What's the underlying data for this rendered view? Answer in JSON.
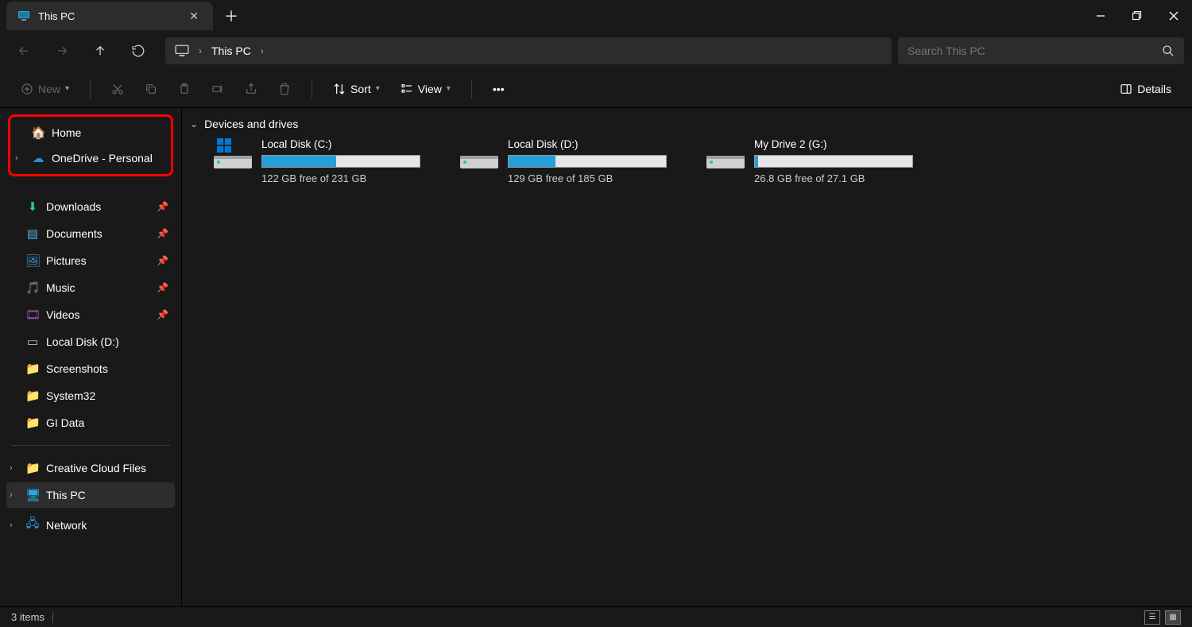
{
  "window": {
    "tab_title": "This PC",
    "search_placeholder": "Search This PC"
  },
  "address": {
    "segment": "This PC"
  },
  "toolbar": {
    "new": "New",
    "sort": "Sort",
    "view": "View",
    "details": "Details"
  },
  "sidebar": {
    "home": "Home",
    "onedrive": "OneDrive - Personal",
    "downloads": "Downloads",
    "documents": "Documents",
    "pictures": "Pictures",
    "music": "Music",
    "videos": "Videos",
    "local_disk_d": "Local Disk (D:)",
    "screenshots": "Screenshots",
    "system32": "System32",
    "gi_data": "GI Data",
    "creative_cloud": "Creative Cloud Files",
    "this_pc": "This PC",
    "network": "Network"
  },
  "main": {
    "section": "Devices and drives",
    "drives": [
      {
        "name": "Local Disk (C:)",
        "free": "122 GB free of 231 GB",
        "fill_pct": 47
      },
      {
        "name": "Local Disk (D:)",
        "free": "129 GB free of 185 GB",
        "fill_pct": 30
      },
      {
        "name": "My Drive 2 (G:)",
        "free": "26.8 GB free of 27.1 GB",
        "fill_pct": 2
      }
    ]
  },
  "status": {
    "items": "3 items"
  }
}
